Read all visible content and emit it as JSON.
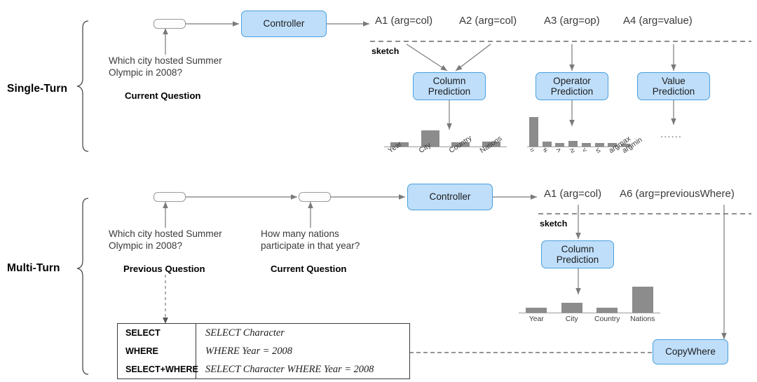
{
  "diagram": {
    "title_rows": [
      {
        "label": "Single-Turn"
      },
      {
        "label": "Multi-Turn"
      }
    ]
  },
  "single_turn": {
    "row_label": "Single-Turn",
    "question_text": "Which city hosted Summer\nOlympic in 2008?",
    "question_caption": "Current Question",
    "controller_label": "Controller",
    "sketch_label": "sketch",
    "actions": [
      {
        "id": "A1",
        "text": "A1 (arg=col)"
      },
      {
        "id": "A2",
        "text": "A2 (arg=col)"
      },
      {
        "id": "A3",
        "text": "A3 (arg=op)"
      },
      {
        "id": "A4",
        "text": "A4 (arg=value)"
      }
    ],
    "modules": [
      {
        "id": "column-prediction",
        "line1": "Column",
        "line2": "Prediction"
      },
      {
        "id": "operator-prediction",
        "line1": "Operator",
        "line2": "Prediction"
      },
      {
        "id": "value-prediction",
        "line1": "Value",
        "line2": "Prediction"
      }
    ],
    "value_prediction_placeholder": "......"
  },
  "multi_turn": {
    "row_label": "Multi-Turn",
    "previous_question_text": "Which city hosted Summer\nOlympic in 2008?",
    "previous_question_caption": "Previous Question",
    "current_question_text": "How many nations\nparticipate in that year?",
    "current_question_caption": "Current Question",
    "controller_label": "Controller",
    "sketch_label": "sketch",
    "actions": [
      {
        "id": "A1",
        "text": "A1 (arg=col)"
      },
      {
        "id": "A6",
        "text": "A6 (arg=previousWhere)"
      }
    ],
    "modules": [
      {
        "id": "column-prediction",
        "line1": "Column",
        "line2": "Prediction"
      }
    ],
    "copy_where_label": "CopyWhere",
    "sql_table": {
      "rows": [
        {
          "clause": "SELECT",
          "sql": "SELECT Character"
        },
        {
          "clause": "WHERE",
          "sql": "WHERE Year  =  2008"
        },
        {
          "clause": "SELECT+WHERE",
          "sql": "SELECT Character WHERE Year  =  2008"
        }
      ]
    }
  },
  "chart_data": [
    {
      "id": "single-turn-column-prediction-chart",
      "type": "bar",
      "title": "Column Prediction",
      "categories": [
        "Year",
        "City",
        "Country",
        "Nations"
      ],
      "values": [
        0.16,
        0.62,
        0.16,
        0.17
      ],
      "ylim": [
        0,
        1
      ],
      "tick_rotation": -34,
      "grid": false,
      "legend": "none"
    },
    {
      "id": "single-turn-operator-prediction-chart",
      "type": "bar",
      "title": "Operator Prediction",
      "categories": [
        "=",
        "≠",
        ">",
        "≥",
        "<",
        "≤",
        "argmax",
        "argmin"
      ],
      "values": [
        1.0,
        0.16,
        0.12,
        0.18,
        0.12,
        0.12,
        0.11,
        0.08
      ],
      "ylim": [
        0,
        1
      ],
      "tick_rotation": -34,
      "grid": false,
      "legend": "none"
    },
    {
      "id": "multi-turn-column-prediction-chart",
      "type": "bar",
      "title": "Column Prediction",
      "categories": [
        "Year",
        "City",
        "Country",
        "Nations"
      ],
      "values": [
        0.16,
        0.36,
        0.17,
        0.95
      ],
      "ylim": [
        0,
        1
      ],
      "tick_rotation": 0,
      "grid": false,
      "legend": "none"
    }
  ],
  "colors": {
    "box_fill": "#bfdefa",
    "box_border": "#49a0db",
    "bar": "#8c8c8c",
    "line": "#7a7a7a",
    "text": "#3a3a3a"
  }
}
